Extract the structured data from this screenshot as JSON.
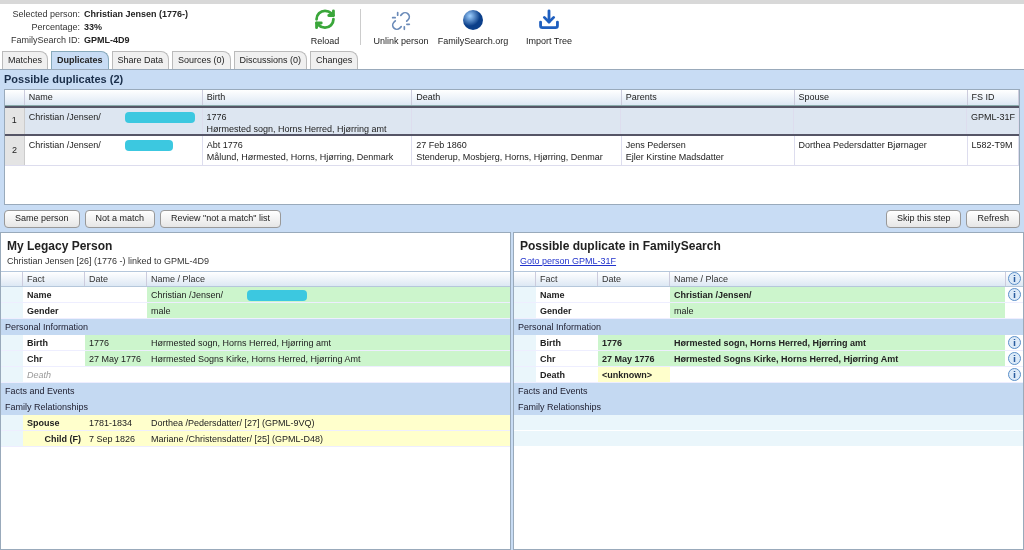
{
  "summary": [
    {
      "label": "Selected person:",
      "value": "Christian Jensen (1776-)"
    },
    {
      "label": "Percentage:",
      "value": "33%"
    },
    {
      "label": "FamilySearch ID:",
      "value": "GPML-4D9"
    }
  ],
  "toolbar": [
    {
      "kind": "reload",
      "label": "Reload"
    },
    {
      "kind": "unlink",
      "label": "Unlink person"
    },
    {
      "kind": "globe",
      "label": "FamilySearch.org"
    },
    {
      "kind": "import",
      "label": "Import Tree"
    }
  ],
  "tabs": [
    {
      "label": "Matches",
      "selected": false
    },
    {
      "label": "Duplicates",
      "selected": true
    },
    {
      "label": "Share Data",
      "selected": false
    },
    {
      "label": "Sources (0)",
      "selected": false
    },
    {
      "label": "Discussions (0)",
      "selected": false
    },
    {
      "label": "Changes",
      "selected": false
    }
  ],
  "duplicates": {
    "title": "Possible duplicates (2)",
    "columns": [
      "Name",
      "Birth",
      "Death",
      "Parents",
      "Spouse",
      "FS ID"
    ],
    "rows": [
      {
        "index": "1",
        "selected": true,
        "cells": [
          [
            "Christian /Jensen/"
          ],
          [
            "1776",
            "Hørmested sogn, Horns Herred, Hjørring amt"
          ],
          [],
          [],
          [],
          [
            "GPML-31F"
          ]
        ]
      },
      {
        "index": "2",
        "selected": false,
        "cells": [
          [
            "Christian /Jensen/"
          ],
          [
            "Abt 1776",
            "Målund, Hørmested, Horns, Hjørring, Denmark"
          ],
          [
            "27 Feb 1860",
            "Stenderup, Mosbjerg, Horns, Hjørring, Denmar"
          ],
          [
            "Jens Pedersen",
            "Ejler Kirstine Madsdatter"
          ],
          [
            "Dorthea Pedersdatter Bjørnager"
          ],
          [
            "L582-T9M"
          ]
        ]
      }
    ]
  },
  "actions_left": [
    "Same person",
    "Not a match",
    "Review \"not a match\" list"
  ],
  "actions_right": [
    "Skip this step",
    "Refresh"
  ],
  "panels": [
    {
      "title": "My Legacy Person",
      "subtitle": "Christian Jensen [26] (1776 -) linked to GPML-4D9",
      "subtitle_link": false,
      "columns": [
        "Fact",
        "Date",
        "Name / Place"
      ],
      "info_column": false,
      "rows": [
        {
          "kind": "fact",
          "fact": "Name",
          "date": "",
          "place": "Christian /Jensen/",
          "agrees": true,
          "date_marked": false,
          "place_marked": true,
          "bold": false
        },
        {
          "kind": "fact",
          "fact": "Gender",
          "date": "",
          "place": "male",
          "agrees": true,
          "date_marked": false,
          "place_marked": true,
          "bold": false
        },
        {
          "kind": "section",
          "label": "Personal Information"
        },
        {
          "kind": "fact",
          "fact": "Birth",
          "date": "1776",
          "place": "Hørmested sogn, Horns Herred, Hjørring amt",
          "agrees": true,
          "date_marked": true,
          "place_marked": true,
          "bold": false
        },
        {
          "kind": "fact",
          "fact": "Chr",
          "date": "27 May 1776",
          "place": "Hørmested Sogns Kirke, Horns Herred, Hjørring Amt",
          "agrees": true,
          "date_marked": true,
          "place_marked": true,
          "bold": false
        },
        {
          "kind": "missing",
          "fact": "Death",
          "date": "",
          "place": "",
          "date_marked": false,
          "place_marked": false
        },
        {
          "kind": "section",
          "label": "Facts and Events"
        },
        {
          "kind": "section",
          "label": "Family Relationships"
        },
        {
          "kind": "relation",
          "fact": "Spouse",
          "date": "1781-1834",
          "place": "Dorthea /Pedersdatter/ [27] (GPML-9VQ)",
          "agrees": false,
          "date_marked": true,
          "place_marked": true,
          "bold": false
        },
        {
          "kind": "child",
          "fact": "Child (F)",
          "date": "7 Sep 1826",
          "place": "Mariane /Christensdatter/ [25] (GPML-D48)",
          "agrees": false,
          "date_marked": true,
          "place_marked": true,
          "bold": false
        }
      ]
    },
    {
      "title": "Possible duplicate in FamilySearch",
      "subtitle": "Goto person GPML-31F",
      "subtitle_link": true,
      "columns": [
        "Fact",
        "Date",
        "Name / Place"
      ],
      "info_column": true,
      "rows": [
        {
          "kind": "fact",
          "fact": "Name",
          "date": "",
          "place": "Christian /Jensen/",
          "agrees": true,
          "date_marked": false,
          "place_marked": true,
          "bold": true,
          "info": true
        },
        {
          "kind": "fact",
          "fact": "Gender",
          "date": "",
          "place": "male",
          "agrees": true,
          "date_marked": false,
          "place_marked": true,
          "bold": false,
          "info": false
        },
        {
          "kind": "section",
          "label": "Personal Information"
        },
        {
          "kind": "fact",
          "fact": "Birth",
          "date": "1776",
          "place": "Hørmested sogn, Horns Herred, Hjørring amt",
          "agrees": true,
          "date_marked": true,
          "place_marked": true,
          "bold": true,
          "info": true
        },
        {
          "kind": "fact",
          "fact": "Chr",
          "date": "27 May 1776",
          "place": "Hørmested Sogns Kirke, Horns Herred, Hjørring Amt",
          "agrees": true,
          "date_marked": true,
          "place_marked": true,
          "bold": true,
          "info": true
        },
        {
          "kind": "fact",
          "fact": "Death",
          "date": "<unknown>",
          "place": "",
          "agrees": false,
          "date_marked": true,
          "place_marked": false,
          "bold": true,
          "info": true
        },
        {
          "kind": "section",
          "label": "Facts and Events"
        },
        {
          "kind": "section",
          "label": "Family Relationships"
        },
        {
          "kind": "blank"
        },
        {
          "kind": "blank"
        }
      ]
    }
  ]
}
